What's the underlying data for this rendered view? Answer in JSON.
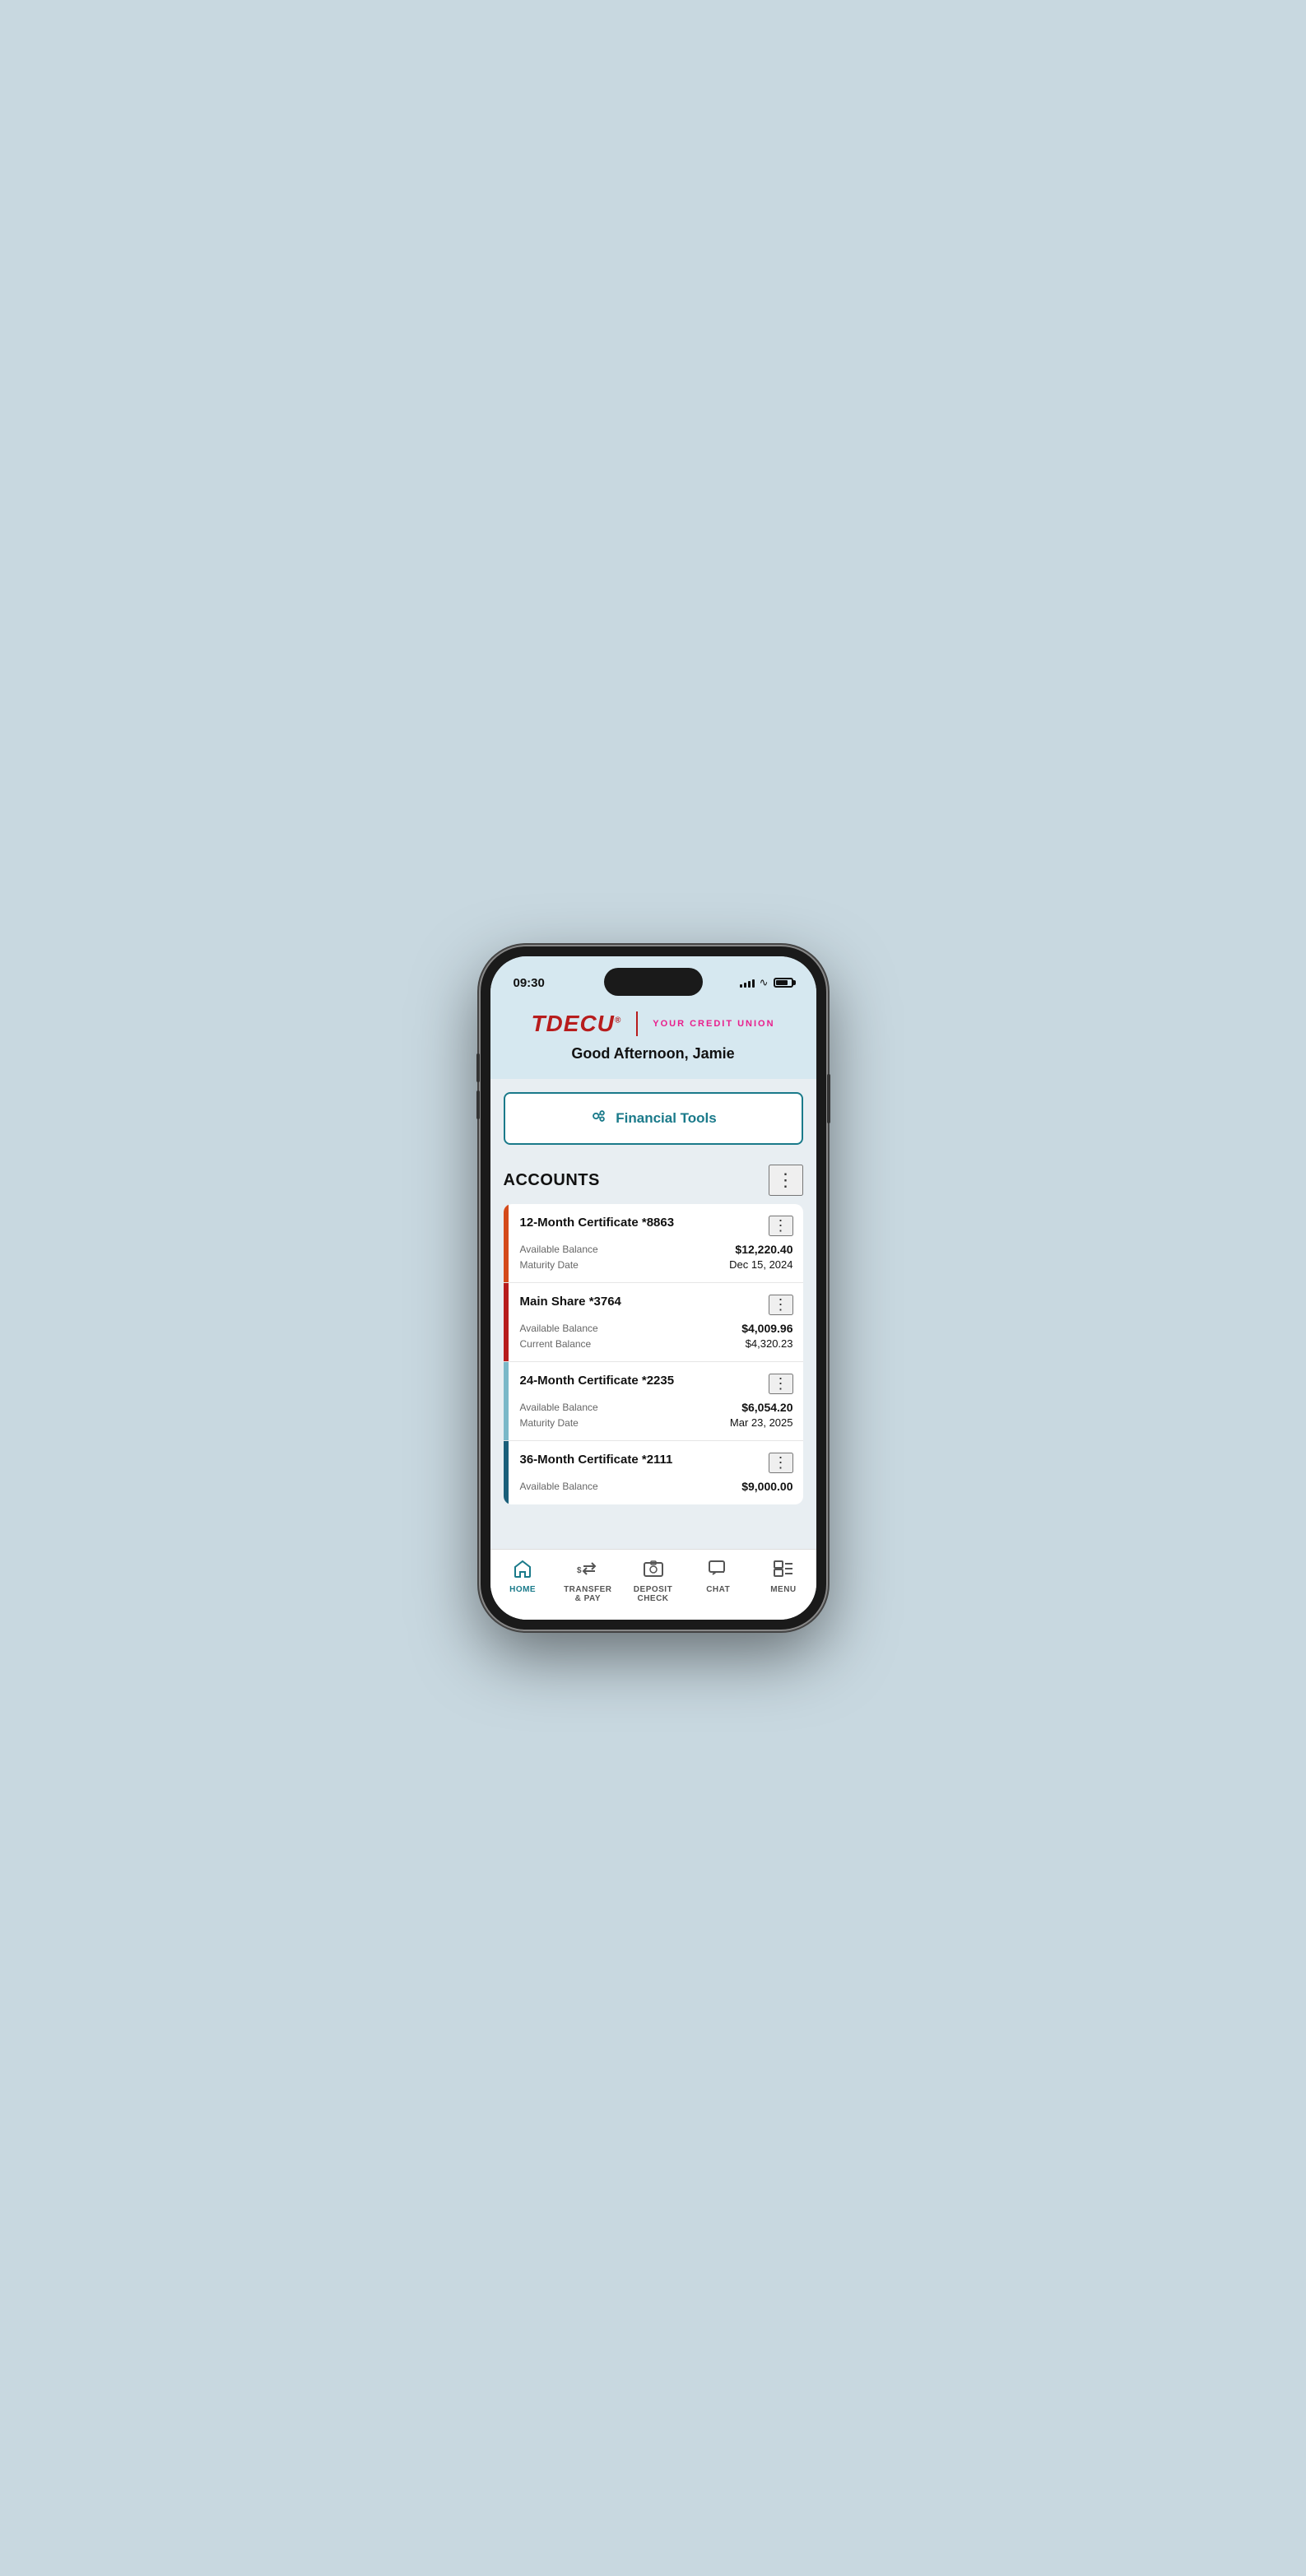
{
  "status": {
    "time": "09:30",
    "signal_bars": [
      3,
      5,
      7,
      9,
      11
    ],
    "wifi": "wifi",
    "battery_level": 80
  },
  "header": {
    "logo_tdecu": "TDECU",
    "logo_registered": "®",
    "logo_tagline": "YOUR CREDIT UNION",
    "greeting": "Good Afternoon, Jamie"
  },
  "financial_tools": {
    "label": "Financial Tools",
    "icon": "⚙"
  },
  "accounts": {
    "title": "ACCOUNTS",
    "more_label": "⋮",
    "items": [
      {
        "name": "12-Month Certificate *8863",
        "color": "#d44a1a",
        "details": [
          {
            "label": "Available Balance",
            "value": "$12,220.40",
            "bold": true
          },
          {
            "label": "Maturity Date",
            "value": "Dec 15, 2024",
            "bold": false
          }
        ]
      },
      {
        "name": "Main Share *3764",
        "color": "#b71c1c",
        "details": [
          {
            "label": "Available Balance",
            "value": "$4,009.96",
            "bold": true
          },
          {
            "label": "Current Balance",
            "value": "$4,320.23",
            "bold": false
          }
        ]
      },
      {
        "name": "24-Month Certificate *2235",
        "color": "#7ab8c8",
        "details": [
          {
            "label": "Available Balance",
            "value": "$6,054.20",
            "bold": true
          },
          {
            "label": "Maturity Date",
            "value": "Mar 23, 2025",
            "bold": false
          }
        ]
      },
      {
        "name": "36-Month Certificate *2111",
        "color": "#1a5f7a",
        "details": [
          {
            "label": "Available Balance",
            "value": "$9,000.00",
            "bold": true
          }
        ]
      }
    ]
  },
  "bottom_nav": {
    "items": [
      {
        "id": "home",
        "label": "HOME",
        "active": true
      },
      {
        "id": "transfer",
        "label": "TRANSFER\n& PAY",
        "active": false
      },
      {
        "id": "deposit",
        "label": "DEPOSIT\nCHECK",
        "active": false
      },
      {
        "id": "chat",
        "label": "CHAT",
        "active": false
      },
      {
        "id": "menu",
        "label": "MENU",
        "active": false
      }
    ]
  }
}
